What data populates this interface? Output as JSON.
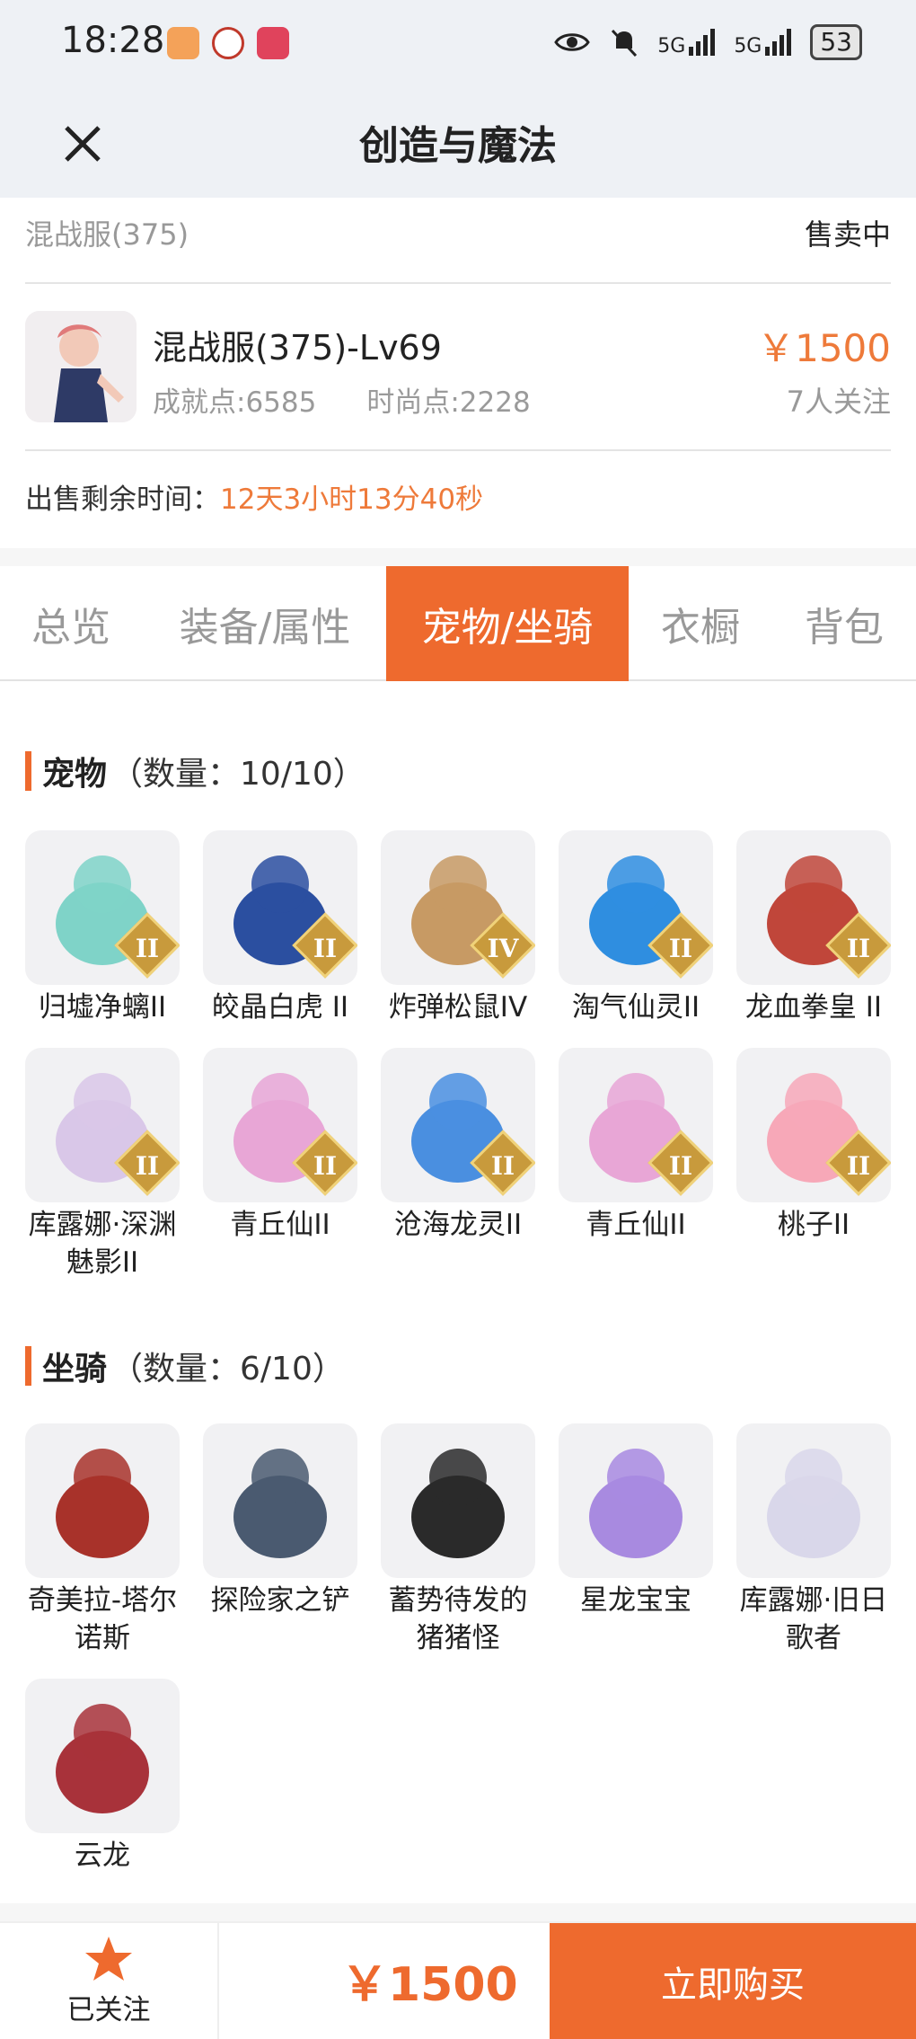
{
  "status_bar": {
    "time": "18:28",
    "signal_1": "5G",
    "signal_2": "5G",
    "battery": "53"
  },
  "nav": {
    "title": "创造与魔法",
    "close_icon": "close-icon"
  },
  "listing": {
    "server": "混战服(375)",
    "status": "售卖中",
    "title": "混战服(375)-Lv69",
    "achievement": "成就点:6585",
    "fashion": "时尚点:2228",
    "price": "￥1500",
    "followers": "7人关注",
    "remaining_label": "出售剩余时间：",
    "remaining_value": "12天3小时13分40秒"
  },
  "tabs": [
    {
      "label": "总览"
    },
    {
      "label": "装备/属性"
    },
    {
      "label": "宠物/坐骑",
      "active": true
    },
    {
      "label": "衣橱"
    },
    {
      "label": "背包"
    }
  ],
  "pets": {
    "title": "宠物",
    "count": "（数量：10/10）",
    "items": [
      {
        "name": "归墟净螭II",
        "grade": "II",
        "color": "#7fd3c8"
      },
      {
        "name": "皎晶白虎 II",
        "grade": "II",
        "color": "#2b4fa0"
      },
      {
        "name": "炸弹松鼠IV",
        "grade": "IV",
        "color": "#c79a64"
      },
      {
        "name": "淘气仙灵II",
        "grade": "II",
        "color": "#2f8ee0"
      },
      {
        "name": "龙血拳皇 II",
        "grade": "II",
        "color": "#c0463a"
      },
      {
        "name": "库露娜·深渊魅影II",
        "grade": "II",
        "color": "#d9c7e8"
      },
      {
        "name": "青丘仙II",
        "grade": "II",
        "color": "#e8a6d6"
      },
      {
        "name": "沧海龙灵II",
        "grade": "II",
        "color": "#4a8fe0"
      },
      {
        "name": "青丘仙II",
        "grade": "II",
        "color": "#e8a6d6"
      },
      {
        "name": "桃子II",
        "grade": "II",
        "color": "#f7a8b8"
      }
    ]
  },
  "mounts": {
    "title": "坐骑",
    "count": "（数量：6/10）",
    "items": [
      {
        "name": "奇美拉-塔尔诺斯",
        "color": "#a8322a"
      },
      {
        "name": "探险家之铲",
        "color": "#4a5a70"
      },
      {
        "name": "蓄势待发的猪猪怪",
        "color": "#2a2a2a"
      },
      {
        "name": "星龙宝宝",
        "color": "#a88ae0"
      },
      {
        "name": "库露娜·旧日歌者",
        "color": "#d9d7ea"
      },
      {
        "name": "云龙",
        "color": "#a8323a"
      }
    ]
  },
  "bottom": {
    "follow_label": "已关注",
    "price": "￥1500",
    "buy_label": "立即购买"
  },
  "colors": {
    "accent": "#ee6a2e",
    "price": "#ee7a3a"
  }
}
